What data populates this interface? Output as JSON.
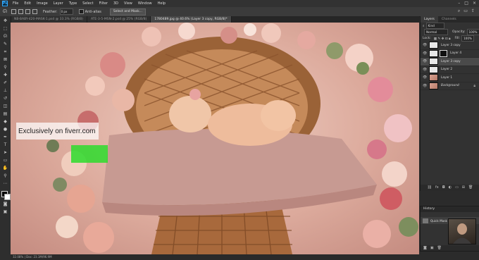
{
  "menubar": {
    "app_icon": "Ps",
    "items": [
      "File",
      "Edit",
      "Image",
      "Layer",
      "Type",
      "Select",
      "Filter",
      "3D",
      "View",
      "Window",
      "Help"
    ]
  },
  "options_bar": {
    "feather_label": "Feather:",
    "feather_value": "0 px",
    "antialias_label": "Anti-alias",
    "select_mask_button": "Select and Mask..."
  },
  "doc_tabs": [
    {
      "label": "NB-BABY-420-MASK-1.psd @ 33.3% (RGB/8)"
    },
    {
      "label": "ATE-3-5-MSN-2.psd @ 25% (RGB/8)"
    },
    {
      "label": "1780489.jpg @ 40.6% (Layer 3 copy, RGB/8)*",
      "active": true
    }
  ],
  "status": {
    "text": "32.08% | Doc: 23.1M/96.9M"
  },
  "watermark": {
    "text": "Exclusively on fiverr.com"
  },
  "layers_panel": {
    "tabs": [
      "Layers",
      "Channels"
    ],
    "kind_label": "Kind",
    "blend_mode": "Normal",
    "opacity_label": "Opacity:",
    "opacity_value": "100%",
    "lock_label": "Lock:",
    "fill_label": "Fill:",
    "fill_value": "100%",
    "layers": [
      {
        "name": "Layer 3 copy",
        "thumb": "white",
        "mask": false,
        "active": false
      },
      {
        "name": "Layer 4",
        "thumb": "white",
        "mask": true,
        "active": false
      },
      {
        "name": "Layer 3 copy",
        "thumb": "white",
        "mask": false,
        "active": true
      },
      {
        "name": "Layer 2",
        "thumb": "white",
        "mask": false,
        "active": false
      },
      {
        "name": "Layer 1",
        "thumb": "photo",
        "mask": false,
        "active": false
      },
      {
        "name": "Background",
        "thumb": "photo",
        "mask": false,
        "active": false,
        "locked": true
      }
    ]
  },
  "history_panel": {
    "title": "History",
    "item": "Quick Mask"
  },
  "colors": {
    "watermark_highlight": "#2ddc2d",
    "canvas_bg": "#e3b8ab"
  }
}
